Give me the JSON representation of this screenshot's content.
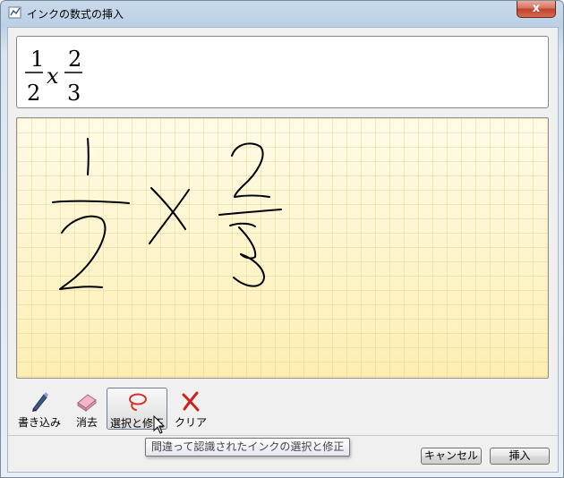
{
  "window": {
    "title": "インクの数式の挿入",
    "close_label": "x"
  },
  "preview": {
    "num1": "1",
    "den1": "2",
    "op": "x",
    "num2": "2",
    "den2": "3"
  },
  "toolbar": {
    "tools": [
      {
        "label": "書き込み",
        "icon": "pen-icon"
      },
      {
        "label": "消去",
        "icon": "eraser-icon"
      },
      {
        "label": "選択と修正",
        "icon": "lasso-icon",
        "selected": true
      },
      {
        "label": "クリア",
        "icon": "clear-x-icon"
      }
    ]
  },
  "tooltip": "間違って認識されたインクの選択と修正",
  "buttons": {
    "cancel": "キャンセル",
    "insert": "挿入"
  },
  "colors": {
    "ink": "#000000",
    "canvas": "#fdf3c6",
    "grid": "#eccc8c",
    "clear": "#d22020",
    "lasso": "#d0352a"
  }
}
